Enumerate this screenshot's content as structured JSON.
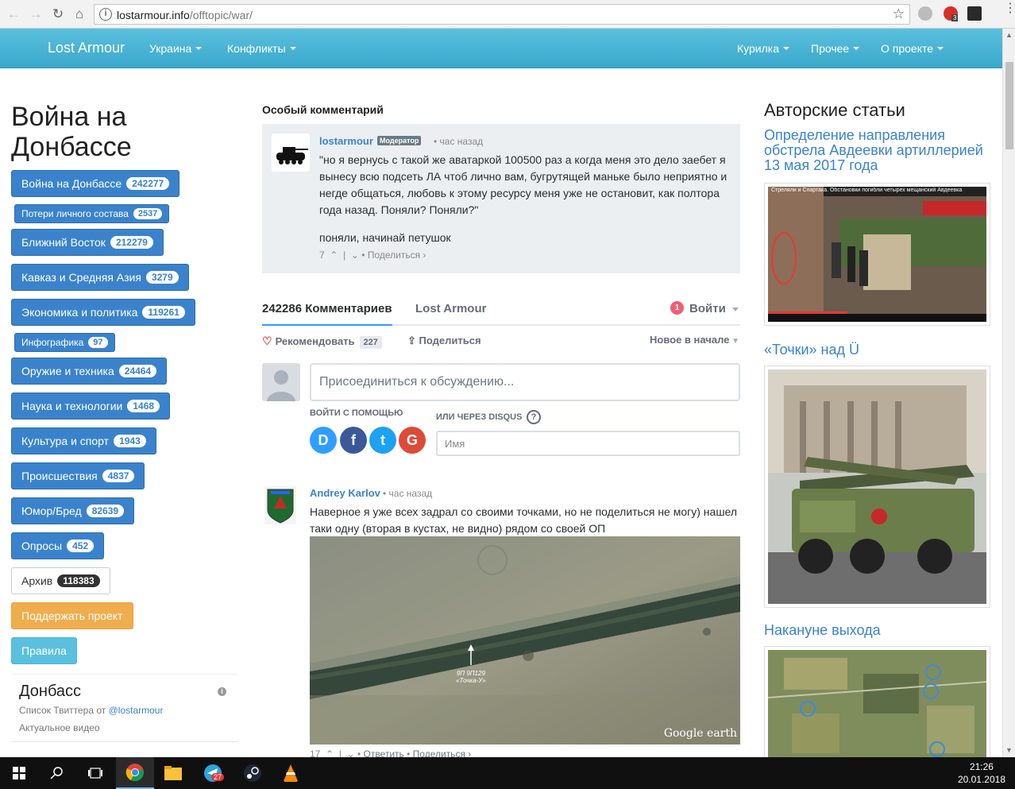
{
  "browser": {
    "url_host": "lostarmour.info",
    "url_path": "/offtopic/war/",
    "ext_badge_count": "3"
  },
  "navbar": {
    "brand": "Lost Armour",
    "left_items": [
      "Украина",
      "Конфликты"
    ],
    "right_items": [
      "Курилка",
      "Прочее",
      "О проекте"
    ]
  },
  "sidebar": {
    "page_title": "Война на Донбассе",
    "categories": [
      {
        "label": "Война на Донбассе",
        "count": "242277"
      },
      {
        "label": "Потери личного состава",
        "count": "2537"
      },
      {
        "label": "Ближний Восток",
        "count": "212279"
      },
      {
        "label": "Кавказ и Средняя Азия",
        "count": "3279"
      },
      {
        "label": "Экономика и политика",
        "count": "119261"
      },
      {
        "label": "Инфографика",
        "count": "97"
      },
      {
        "label": "Оружие и техника",
        "count": "24464"
      },
      {
        "label": "Наука и технологии",
        "count": "1468"
      },
      {
        "label": "Культура и спорт",
        "count": "1943"
      },
      {
        "label": "Происшествия",
        "count": "4837"
      },
      {
        "label": "Юмор/Бред",
        "count": "82639"
      },
      {
        "label": "Опросы",
        "count": "452"
      },
      {
        "label": "Архив",
        "count": "118383"
      }
    ],
    "support_label": "Поддержать проект",
    "rules_label": "Правила",
    "twitter": {
      "title": "Донбасс",
      "subtitle_prefix": "Список Твиттера от ",
      "subtitle_link": "@lostarmour",
      "video_label": "Актуальное видео"
    }
  },
  "special_comment": {
    "heading": "Особый комментарий",
    "author": "lostarmour",
    "badge": "Модератор",
    "time": "час назад",
    "text": "\"но я вернусь с такой же аватаркой 100500 раз а когда меня это дело заебет я вынесу всю подсеть ЛА чтоб лично вам, бугрутящей маньке было неприятно и негде общаться, любовь к этому ресурсу меня уже не остановит, как полтора года назад. Поняли? Поняли?\"",
    "reply": "поняли, начинай петушок",
    "votes": "7",
    "share": "Поделиться ›"
  },
  "disqus": {
    "comments_tab": "242286 Комментариев",
    "community_tab": "Lost Armour",
    "notif_count": "1",
    "login_label": "Войти",
    "recommend_label": "Рекомендовать",
    "recommend_count": "227",
    "share_label": "Поделиться",
    "sort_label": "Новое в начале",
    "composer_placeholder": "Присоединиться к обсуждению...",
    "login_with_label": "ВОЙТИ С ПОМОЩЬЮ",
    "or_disqus_label": "ИЛИ ЧЕРЕЗ DISQUS",
    "name_placeholder": "Имя",
    "social": [
      "D",
      "f",
      "t",
      "G"
    ]
  },
  "comment2": {
    "author": "Andrey Karlov",
    "time": "час назад",
    "text": "Наверное я уже всех задрал со своими точками, но не поделиться не могу) нашел таки одну (вторая в кустах, не видно) рядом со своей ОП",
    "image_label_1": "9П 9П129",
    "image_label_2": "«Точка-У»",
    "image_brand": "Google earth",
    "votes": "17",
    "reply": "Ответить",
    "share": "Поделиться ›"
  },
  "right_column": {
    "title": "Авторские статьи",
    "articles": [
      {
        "title": "Определение направления обстрела Авдеевки артиллерией 13 мая 2017 года",
        "video_caption": "Стреляли и Спартака. Обстановки погибли четырех мещанский Авдеевка"
      },
      {
        "title": "«Точки» над Ü"
      },
      {
        "title": "Накануне выхода"
      }
    ]
  },
  "taskbar": {
    "time": "21:26",
    "date": "20.01.2018",
    "telegram_badge": "27"
  }
}
